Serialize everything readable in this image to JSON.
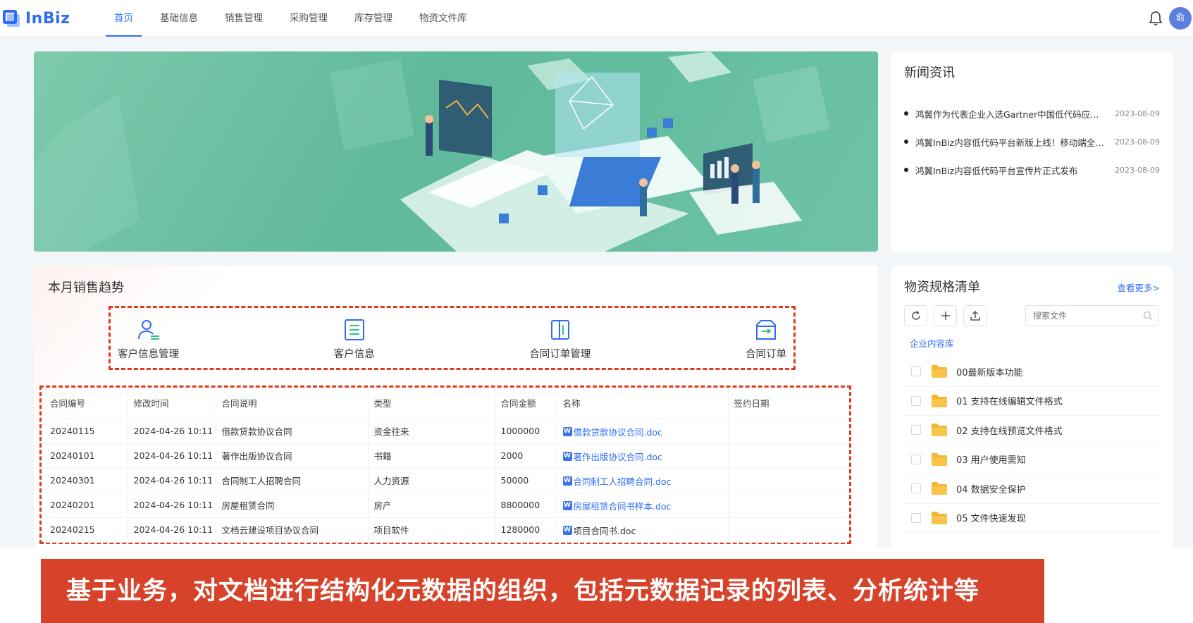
{
  "app": {
    "logo_text": "InBiz",
    "user_initial": "俞"
  },
  "nav": {
    "items": [
      "首页",
      "基础信息",
      "销售管理",
      "采购管理",
      "库存管理",
      "物资文件库"
    ],
    "active": 0
  },
  "news": {
    "title": "新闻资讯",
    "items": [
      {
        "text": "鸿翼作为代表企业入选Gartner中国低代码应用平台",
        "date": "2023-08-09"
      },
      {
        "text": "鸿翼InBiz内容低代码平台新版上线！移动端全面升级",
        "date": "2023-08-09"
      },
      {
        "text": "鸿翼InBiz内容低代码平台宣传片正式发布",
        "date": "2023-08-09"
      }
    ]
  },
  "trend": {
    "title": "本月销售趋势",
    "shortcuts": [
      {
        "label": "客户信息管理",
        "icon": "user-manage-icon"
      },
      {
        "label": "客户信息",
        "icon": "document-list-icon"
      },
      {
        "label": "合同订单管理",
        "icon": "contract-book-icon"
      },
      {
        "label": "合同订单",
        "icon": "order-box-icon"
      }
    ],
    "table": {
      "headers": [
        "合同编号",
        "修改时间",
        "合同说明",
        "类型",
        "合同金额",
        "名称",
        "签约日期"
      ],
      "rows": [
        [
          "20240115",
          "2024-04-26 10:11",
          "借款贷款协议合同",
          "资金往来",
          "1000000",
          "借款贷款协议合同.doc",
          ""
        ],
        [
          "20240101",
          "2024-04-26 10:11",
          "著作出版协议合同",
          "书籍",
          "2000",
          "著作出版协议合同.doc",
          ""
        ],
        [
          "20240301",
          "2024-04-26 10:11",
          "合同制工人招聘合同",
          "人力资源",
          "50000",
          "合同制工人招聘合同.doc",
          ""
        ],
        [
          "20240201",
          "2024-04-26 10:11",
          "房屋租赁合同",
          "房产",
          "8800000",
          "房屋租赁合同书样本.doc",
          ""
        ],
        [
          "20240215",
          "2024-04-26 10:11",
          "文档云建设项目协议合同",
          "项目软件",
          "1280000",
          "项目合同书.doc",
          ""
        ]
      ]
    }
  },
  "specs": {
    "title": "物资规格清单",
    "more": "查看更多>",
    "search_placeholder": "搜索文件",
    "library": "企业内容库",
    "folders": [
      "00最新版本功能",
      "01 支持在线编辑文件格式",
      "02 支持在线预览文件格式",
      "03 用户使用需知",
      "04 数据安全保护",
      "05 文件快速发现"
    ]
  },
  "caption": "基于业务，对文档进行结构化元数据的组织，包括元数据记录的列表、分析统计等",
  "colors": {
    "primary": "#2f6cf6",
    "banner_green": "#5fb99a",
    "highlight_red": "#e03a1e",
    "caption_bg": "#d6432a",
    "folder": "#f5b731"
  }
}
